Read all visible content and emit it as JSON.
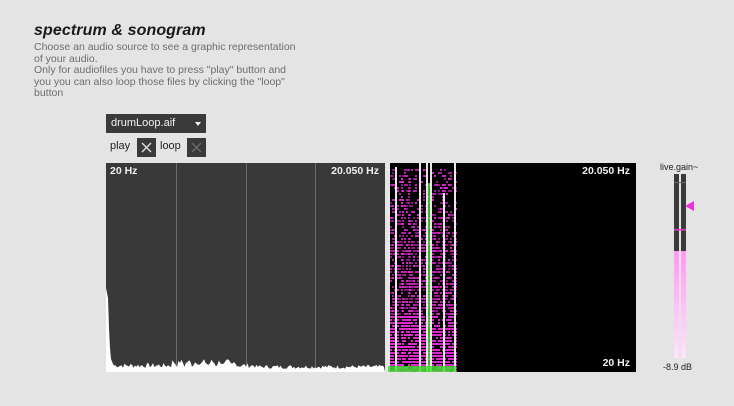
{
  "header": {
    "title": "spectrum & sonogram",
    "description_lines": [
      "Choose an audio source to see a graphic representation",
      "of your audio.",
      "Only for audiofiles you have to press \"play\" button and",
      "you you can also loop those files by clicking the \"loop\"",
      "button"
    ]
  },
  "source_menu": {
    "selected": "drumLoop.aif"
  },
  "play_toggle": {
    "label": "play",
    "checked": true
  },
  "loop_toggle": {
    "label": "loop",
    "checked": false
  },
  "spectrum": {
    "low_label": "20 Hz",
    "high_label": "20.050 Hz",
    "gridlines": 3
  },
  "sonogram": {
    "high_label": "20.050 Hz",
    "low_label": "20 Hz"
  },
  "gain": {
    "label": "live.gain~",
    "value_text": "-8.9 dB",
    "level": 0.58,
    "slider_level": 0.7
  },
  "colors": {
    "background": "#e4e4e4",
    "panel": "#393939",
    "sonogram_bg": "#000000",
    "magenta": "#ff33ee",
    "green": "#44dd33",
    "gain_fill": "#ff99f2",
    "gain_marker": "#ee33dd"
  }
}
